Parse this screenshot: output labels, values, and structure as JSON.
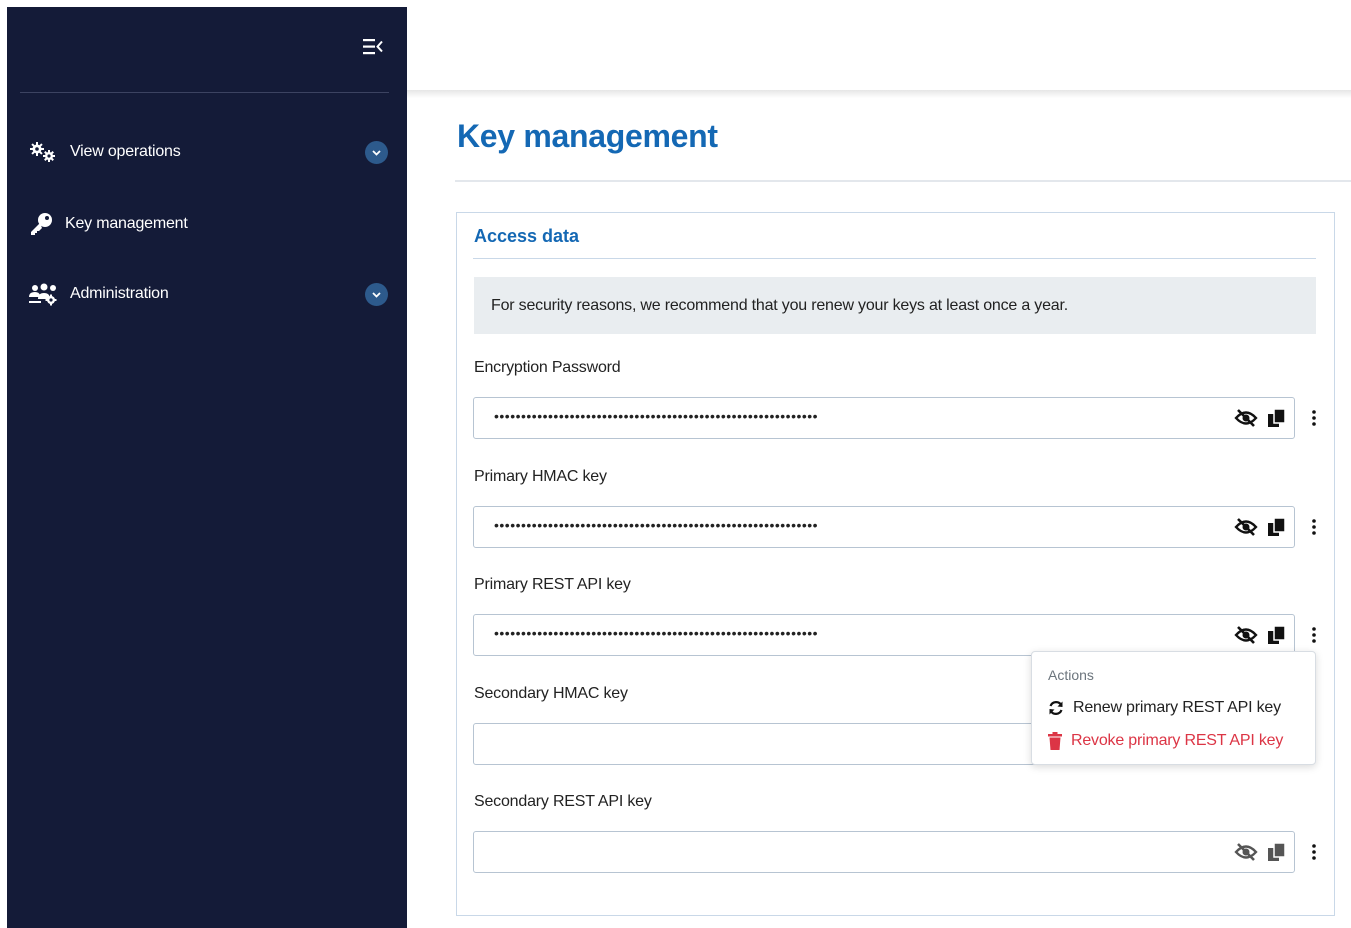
{
  "sidebar": {
    "collapse_icon": "menu-collapse-icon",
    "items": [
      {
        "label": "View operations",
        "icon": "gears-icon",
        "expandable": true
      },
      {
        "label": "Key management",
        "icon": "key-icon",
        "expandable": false
      },
      {
        "label": "Administration",
        "icon": "users-gear-icon",
        "expandable": true
      }
    ]
  },
  "page": {
    "title": "Key management"
  },
  "card": {
    "title": "Access data",
    "notice": "For security reasons, we recommend that you renew your keys at least once a year.",
    "fields": [
      {
        "label": "Encryption Password",
        "value": "••••••••••••••••••••••••••••••••••••••••••••••••••••••••••••"
      },
      {
        "label": "Primary HMAC key",
        "value": "••••••••••••••••••••••••••••••••••••••••••••••••••••••••••••"
      },
      {
        "label": "Primary REST API key",
        "value": "••••••••••••••••••••••••••••••••••••••••••••••••••••••••••••"
      },
      {
        "label": "Secondary HMAC key",
        "value": ""
      },
      {
        "label": "Secondary REST API key",
        "value": ""
      }
    ]
  },
  "actions_menu": {
    "header": "Actions",
    "renew_label": "Renew primary REST API key",
    "revoke_label": "Revoke primary REST API key"
  },
  "colors": {
    "sidebar_bg": "#141b38",
    "accent": "#1468b4",
    "danger": "#dc3545",
    "notice_bg": "#e9edf0"
  }
}
